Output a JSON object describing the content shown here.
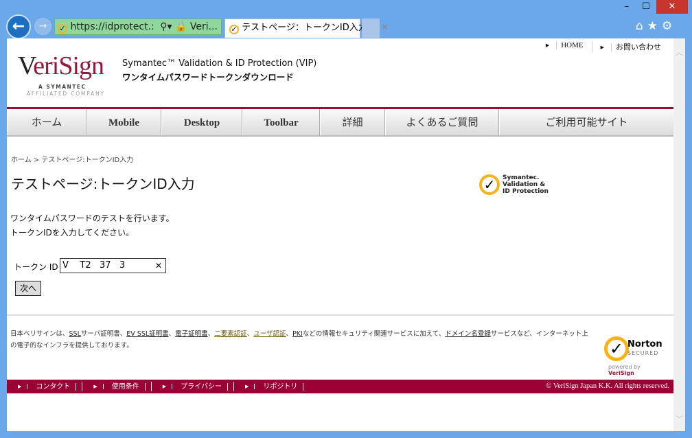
{
  "browser": {
    "address": "https://idprotect.:",
    "site_name": "Veri...",
    "tab_title": "テストページ：トークンID入力...",
    "window_controls": [
      "–",
      "☐",
      "✕"
    ]
  },
  "header": {
    "top_links": [
      "HOME",
      "お問い合わせ"
    ],
    "logo_text": "VeriSign",
    "logo_sub1": "A SYMANTEC",
    "logo_sub2": "AFFILIATED COMPANY",
    "title_line1": "Symantec™ Validation & ID Protection (VIP)",
    "title_line2": "ワンタイムパスワードトークンダウンロード"
  },
  "nav": [
    "ホーム",
    "Mobile",
    "Desktop",
    "Toolbar",
    "詳細",
    "よくあるご質問",
    "ご利用可能サイト"
  ],
  "main": {
    "breadcrumb": "ホーム > テストページ:トークンID入力",
    "heading": "テストページ:トークンID入力",
    "vip_logo": [
      "Symantec.",
      "Validation &",
      "ID Protection"
    ],
    "desc1": "ワンタイムパスワードのテストを行います。",
    "desc2": "トークンIDを入力してください。",
    "token_label": "トークン ID",
    "token_value": "V    T2   37   3",
    "next_button": "次へ"
  },
  "footer": {
    "t1": "日本ベリサインは、",
    "l1": "SSL",
    "t2": "サーバ証明書、",
    "l2": "EV SSL証明書",
    "t3": "、",
    "l3": "電子証明書",
    "t4": "、",
    "l4": "二要素認証",
    "t5": "、",
    "l5": "ユーザ認証",
    "t6": "、",
    "l6": "PKI",
    "t7": "などの情報セキュリティ関連サービスに加えて、",
    "l7": "ドメイン名登録",
    "t8": "サービスなど、インターネット上の電子的なインフラを提供しております。",
    "norton": {
      "title": "Norton",
      "sub": "SECURED",
      "powered": "powered by",
      "brand": "VeriSign"
    },
    "links": [
      "コンタクト",
      "使用条件",
      "プライバシー",
      "リポジトリ"
    ],
    "copyright": "© VeriSign Japan K.K. All rights reserved."
  }
}
